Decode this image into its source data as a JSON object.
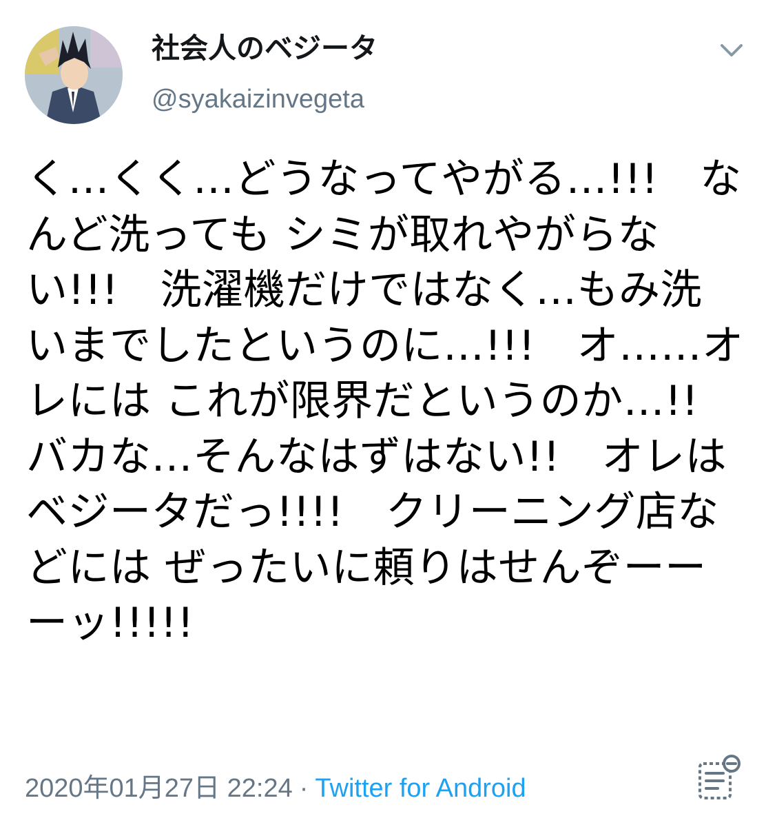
{
  "tweet": {
    "display_name": "社会人のベジータ",
    "handle": "@syakaizinvegeta",
    "lines": [
      "く…くく…どうなってやがる…!!!　な",
      "んど洗っても シミが取れやがらな",
      "い!!!　洗濯機だけではなく…もみ洗",
      "いまでしたというのに…!!!　オ……オ",
      "レには これが限界だというのか…!!",
      "バカな…そんなはずはない!!　オレは",
      "ベジータだっ!!!!　クリーニング店な",
      "どには ぜったいに頼りはせんぞーー",
      "ーッ!!!!!"
    ],
    "timestamp": "2020年01月27日 22:24",
    "separator": "·",
    "source": "Twitter for Android"
  },
  "icons": {
    "menu": "chevron-down-icon",
    "activity": "tweet-activity-icon"
  },
  "colors": {
    "text": "#000000",
    "secondary": "#657786",
    "link": "#1da1f2"
  }
}
